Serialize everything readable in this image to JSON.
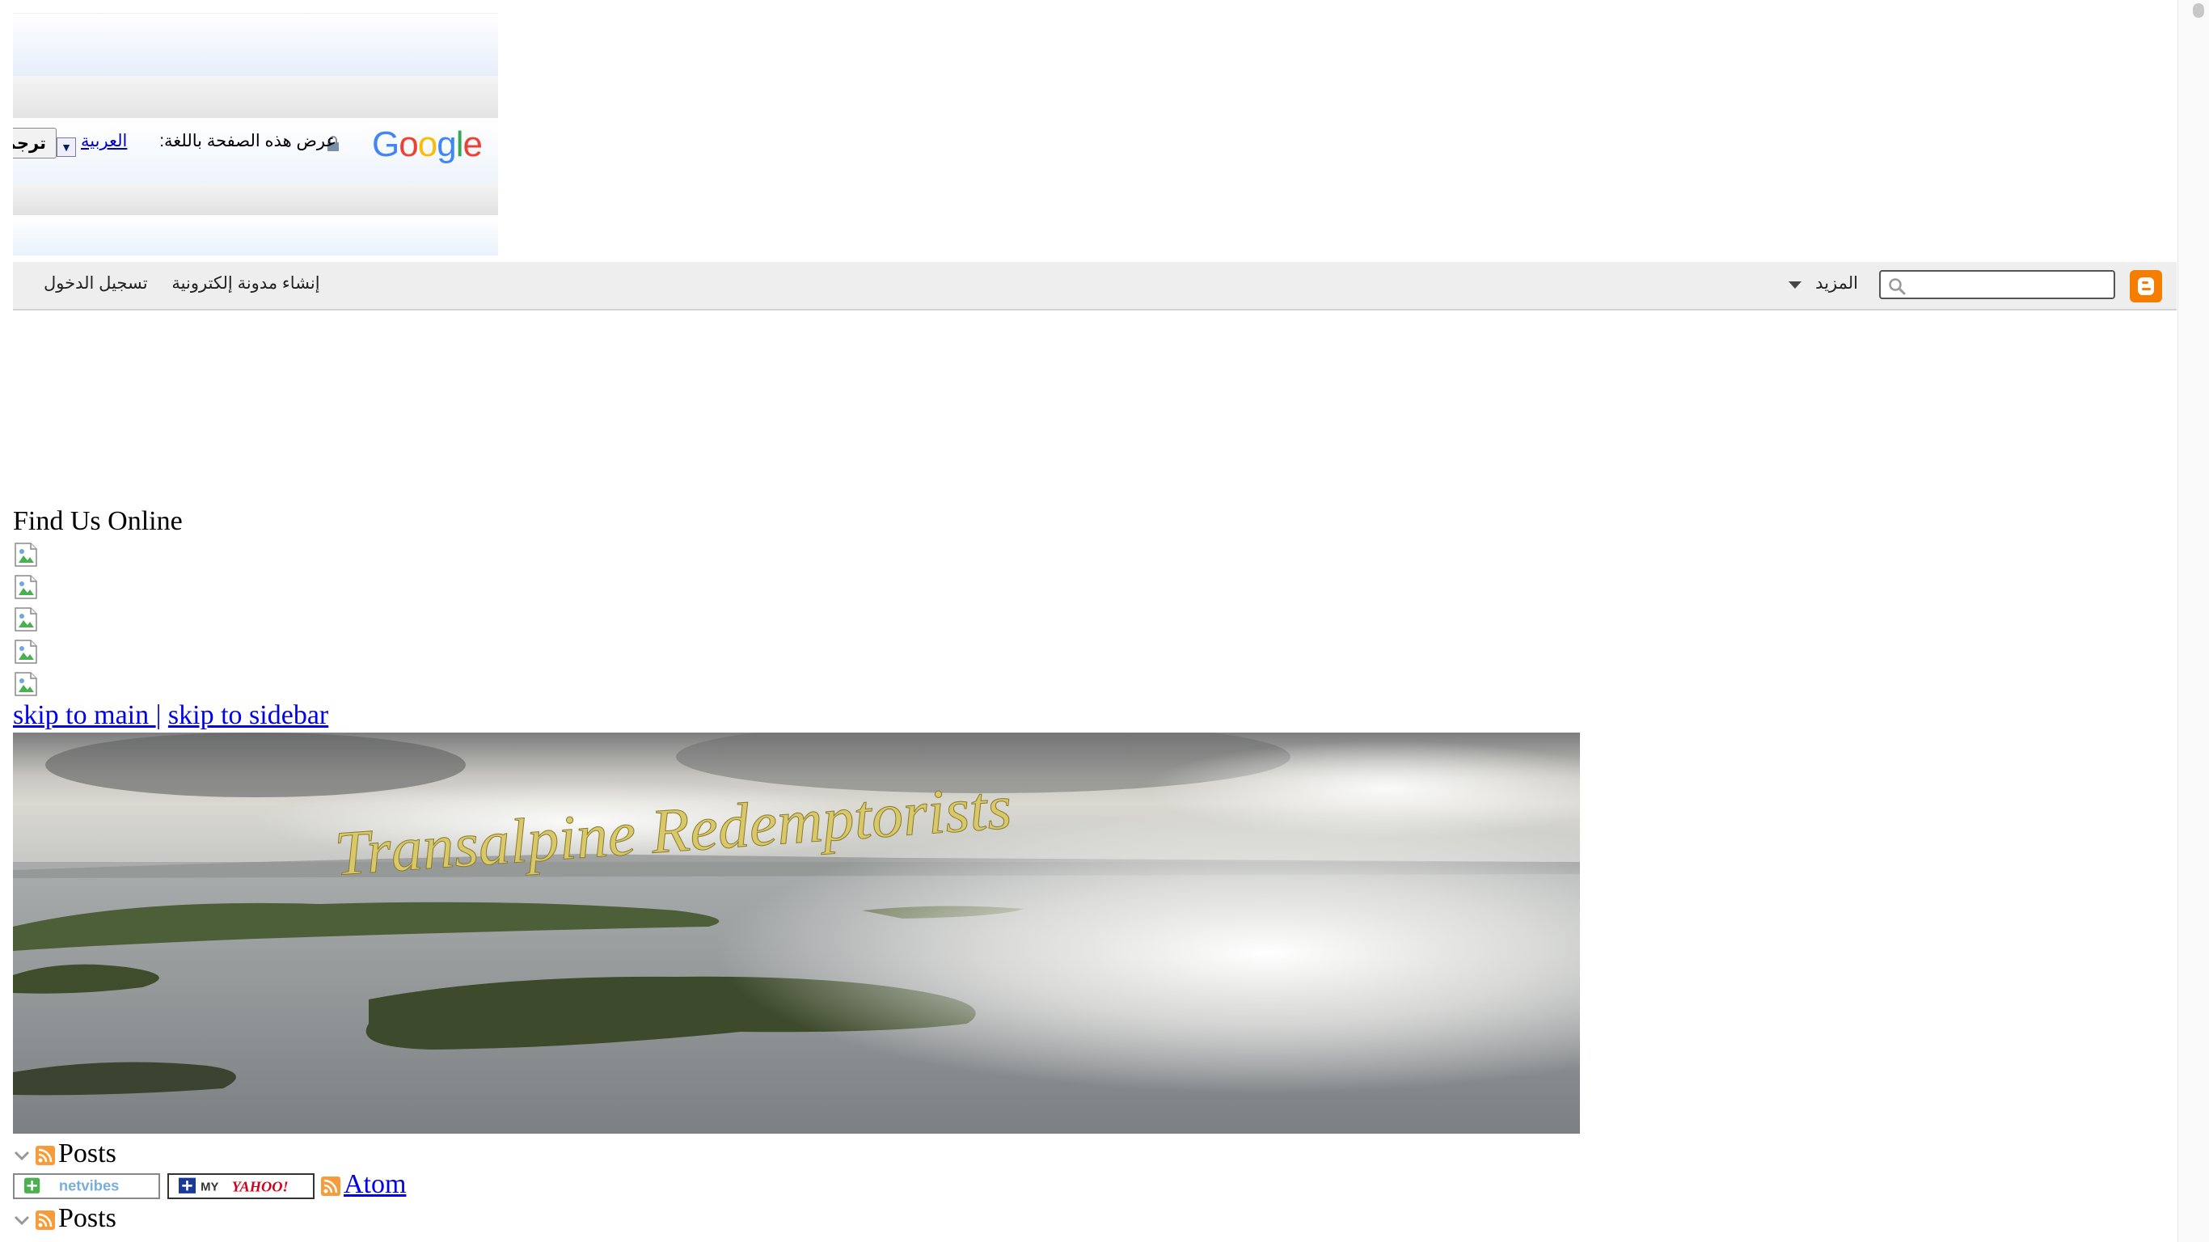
{
  "translate_widget": {
    "logo_letters": [
      "G",
      "o",
      "o",
      "g",
      "l",
      "e"
    ],
    "prompt": "عرض هذه الصفحة باللغة:",
    "language": "العربية",
    "dropdown_arrow": "▼",
    "button_label": "ترجمة"
  },
  "navbar": {
    "search_placeholder": "",
    "more_label": "المزيد",
    "create_blog": "إنشاء مدونة إلكترونية",
    "sign_in": "تسجيل الدخول",
    "brand_color": "#f57d00"
  },
  "sidebar": {
    "find_us_title": "Find Us Online",
    "broken_images": [
      "image-1",
      "image-2",
      "image-3",
      "image-4",
      "image-5"
    ]
  },
  "skip_links": {
    "main": "skip to main ",
    "separator": "|",
    "sidebar": "skip to sidebar"
  },
  "header": {
    "blog_title": "Transalpine Redemptorists"
  },
  "feeds": {
    "posts_label": "Posts",
    "netvibes": "netvibes",
    "myyahoo_my": "MY",
    "myyahoo_yahoo": "YAHOO!",
    "atom": "Atom",
    "posts_label_2": "Posts"
  }
}
